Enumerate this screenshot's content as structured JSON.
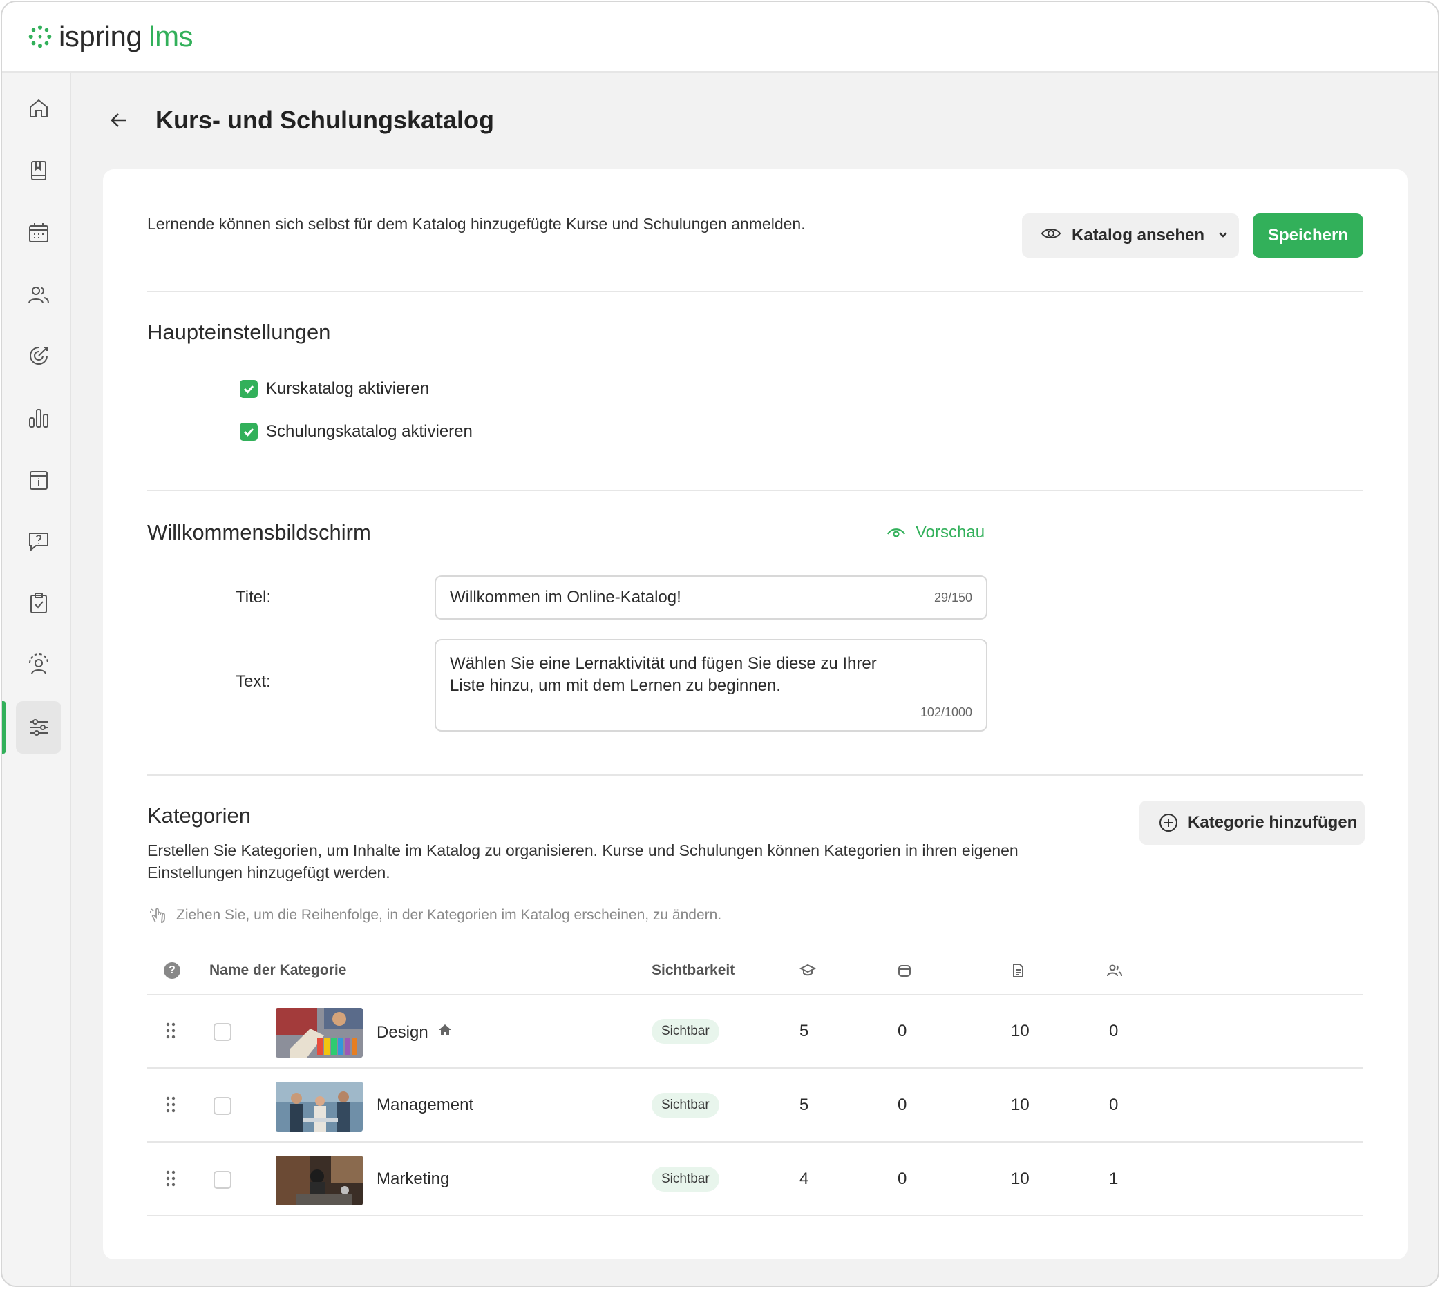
{
  "app": {
    "logo_main": "ispring",
    "logo_sub": "lms"
  },
  "sidebar": {
    "items": [
      {
        "name": "home",
        "icon": "home-icon"
      },
      {
        "name": "courses",
        "icon": "book-icon"
      },
      {
        "name": "calendar",
        "icon": "calendar-icon"
      },
      {
        "name": "users",
        "icon": "users-icon"
      },
      {
        "name": "goals",
        "icon": "target-icon"
      },
      {
        "name": "reports",
        "icon": "bar-chart-icon"
      },
      {
        "name": "info",
        "icon": "info-icon"
      },
      {
        "name": "questions",
        "icon": "question-icon"
      },
      {
        "name": "tasks",
        "icon": "clipboard-icon"
      },
      {
        "name": "profile-settings",
        "icon": "user-gear-icon"
      },
      {
        "name": "settings",
        "icon": "sliders-icon",
        "active": true
      }
    ]
  },
  "page": {
    "title": "Kurs- und Schulungskatalog"
  },
  "intro": "Lernende können sich selbst für dem Katalog hinzugefügte Kurse und Schulungen anmelden.",
  "actions": {
    "view_label": "Katalog ansehen",
    "save_label": "Speichern"
  },
  "main_settings": {
    "title": "Haupteinstellungen",
    "course_catalog": "Kurskatalog aktivieren",
    "training_catalog": "Schulungskatalog aktivieren"
  },
  "welcome": {
    "title": "Willkommensbildschirm",
    "preview_label": "Vorschau",
    "title_label": "Titel:",
    "title_value": "Willkommen im Online-Katalog!",
    "title_counter": "29/150",
    "text_label": "Text:",
    "text_line1": "Wählen Sie eine Lernaktivität und fügen Sie diese zu Ihrer",
    "text_line2": "Liste hinzu, um mit dem Lernen zu beginnen.",
    "text_counter": "102/1000"
  },
  "categories": {
    "title": "Kategorien",
    "add_label": "Kategorie hinzufügen",
    "description": "Erstellen Sie Kategorien, um Inhalte im Katalog zu organisieren. Kurse und Schulungen können Kategorien in ihren eigenen Einstellungen hinzugefügt werden.",
    "hint": "Ziehen Sie, um die Reihenfolge, in der Kategorien im Katalog erscheinen, zu ändern.",
    "columns": {
      "name": "Name der Kategorie",
      "visibility": "Sichtbarkeit"
    },
    "rows": [
      {
        "name": "Design",
        "visibility": "Sichtbar",
        "courses": "5",
        "trainings": "0",
        "docs": "10",
        "groups": "0",
        "home": true
      },
      {
        "name": "Management",
        "visibility": "Sichtbar",
        "courses": "5",
        "trainings": "0",
        "docs": "10",
        "groups": "0"
      },
      {
        "name": "Marketing",
        "visibility": "Sichtbar",
        "courses": "4",
        "trainings": "0",
        "docs": "10",
        "groups": "1"
      }
    ]
  },
  "colors": {
    "accent": "#32b05a"
  }
}
